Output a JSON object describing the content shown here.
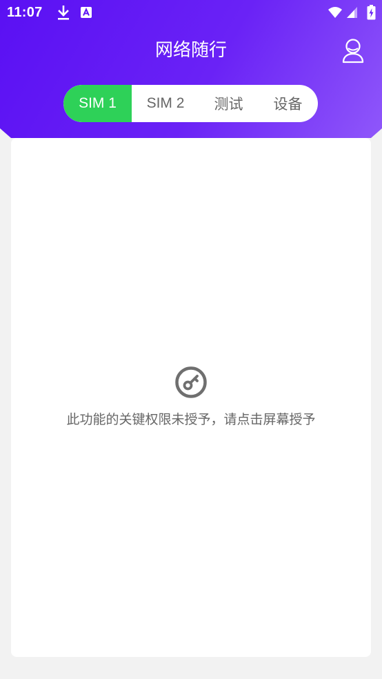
{
  "status_bar": {
    "time": "11:07",
    "icons": [
      "download-icon",
      "app-a-icon",
      "wifi-icon",
      "signal-icon",
      "battery-charging-icon"
    ]
  },
  "header": {
    "title": "网络随行",
    "profile_icon": "user-icon"
  },
  "tabs": [
    {
      "label": "SIM 1",
      "active": true
    },
    {
      "label": "SIM 2",
      "active": false
    },
    {
      "label": "测试",
      "active": false
    },
    {
      "label": "设备",
      "active": false
    }
  ],
  "main": {
    "permission_icon": "key-circle-icon",
    "message": "此功能的关键权限未授予，请点击屏幕授予"
  },
  "colors": {
    "header_start": "#5a10f3",
    "header_end": "#8f57fa",
    "active_tab": "#2ed158",
    "tab_text": "#666666",
    "page_bg": "#f2f2f2",
    "message_text": "#666666",
    "icon_gray": "#6f6f6f"
  }
}
